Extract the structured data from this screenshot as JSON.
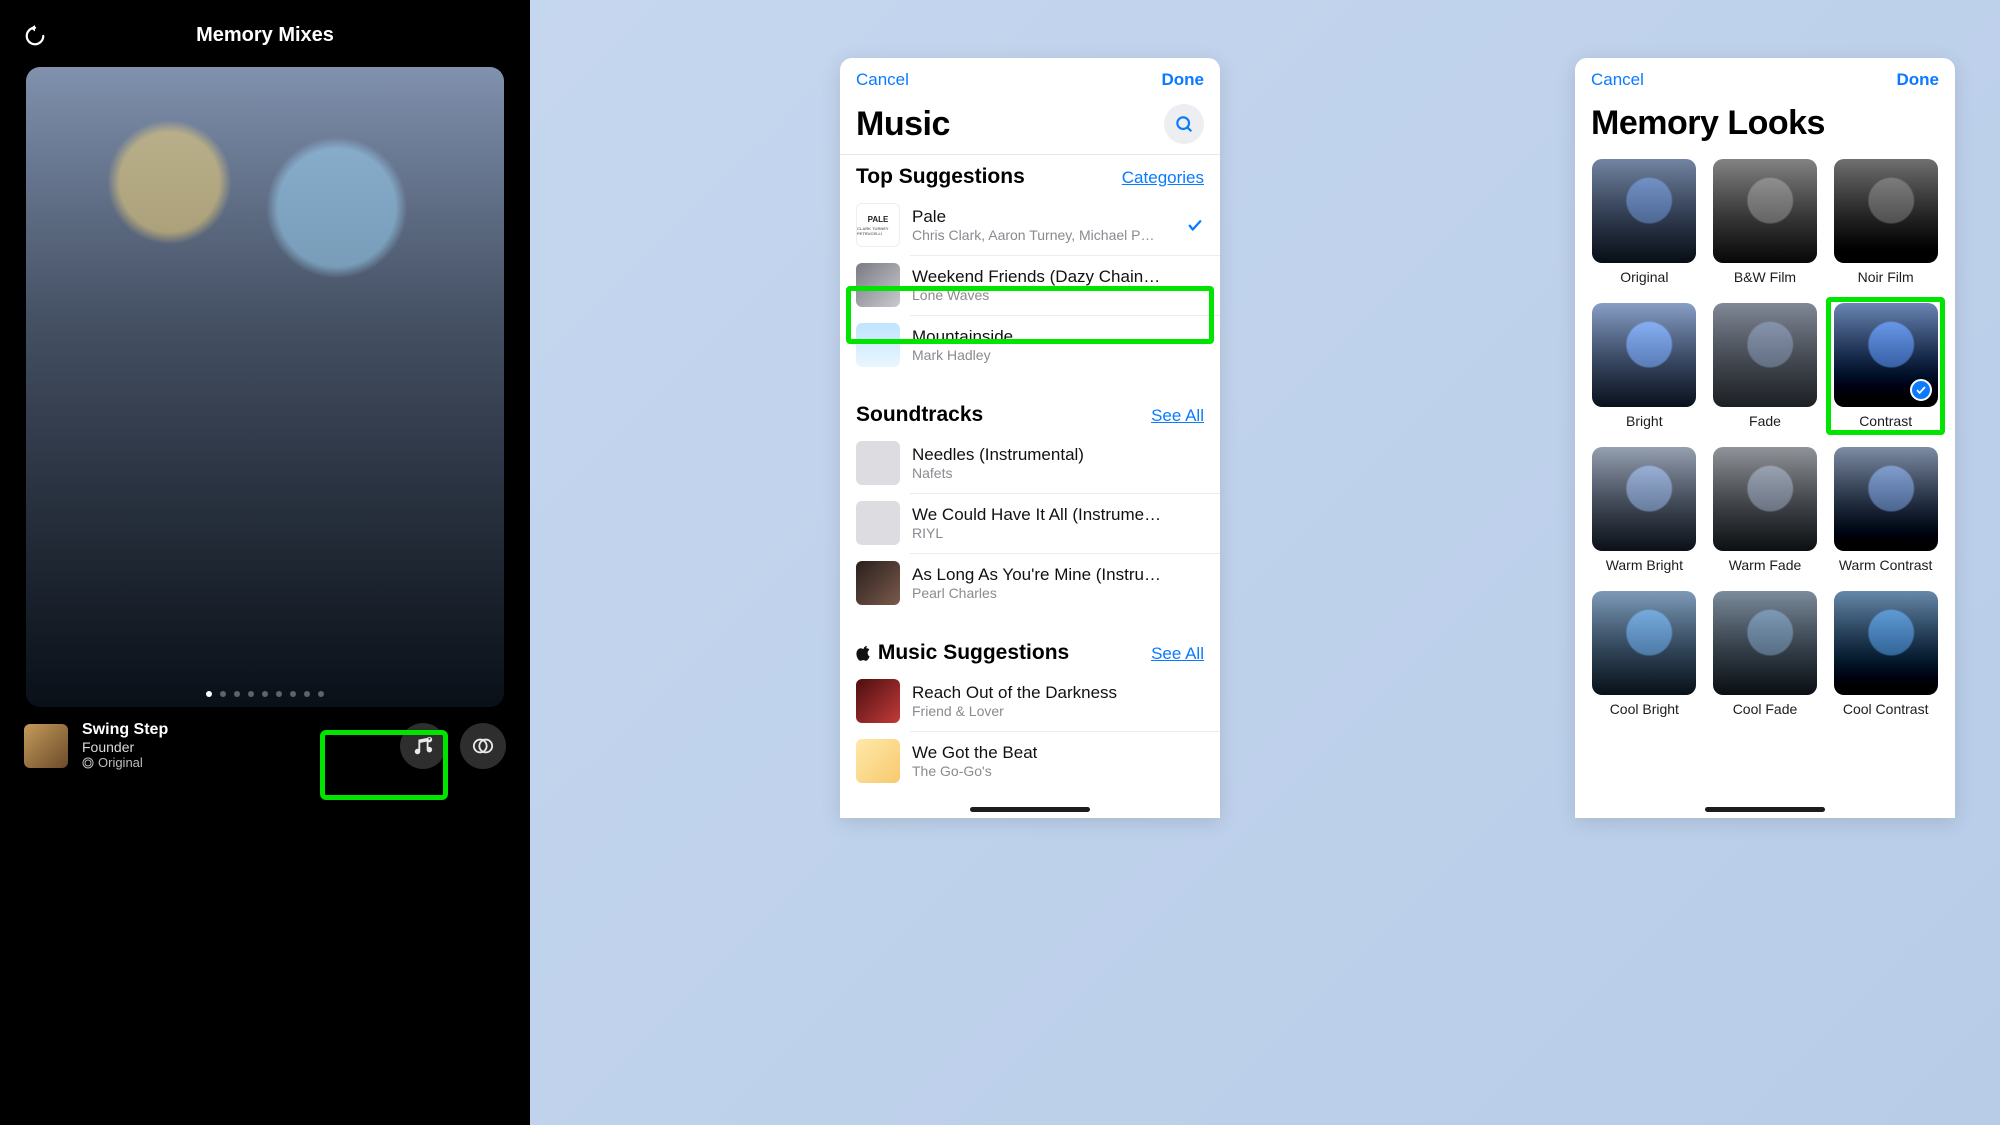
{
  "memory_mixes": {
    "title": "Memory Mixes",
    "dots_total": 9,
    "dots_active_index": 0,
    "track": {
      "title": "Swing Step",
      "artist": "Founder",
      "look_label": "Original"
    }
  },
  "music": {
    "cancel": "Cancel",
    "done": "Done",
    "title": "Music",
    "top_suggestions": {
      "header": "Top Suggestions",
      "link": "Categories",
      "items": [
        {
          "title": "Pale",
          "artist": "Chris Clark, Aaron Turney, Michael Pe…",
          "selected": true,
          "art_text": "PALE"
        },
        {
          "title": "Weekend Friends (Dazy Chain R…",
          "artist": "Lone Waves",
          "selected": false
        },
        {
          "title": "Mountainside",
          "artist": "Mark Hadley",
          "selected": false
        }
      ]
    },
    "soundtracks": {
      "header": "Soundtracks",
      "link": "See All",
      "items": [
        {
          "title": "Needles (Instrumental)",
          "artist": "Nafets"
        },
        {
          "title": "We Could Have It All (Instrumen…",
          "artist": "RIYL"
        },
        {
          "title": "As Long As You're Mine (Instru…",
          "artist": "Pearl Charles"
        }
      ]
    },
    "apple_music": {
      "header": "Music Suggestions",
      "link": "See All",
      "items": [
        {
          "title": "Reach Out of the Darkness",
          "artist": "Friend & Lover"
        },
        {
          "title": "We Got the Beat",
          "artist": "The Go-Go's"
        }
      ]
    }
  },
  "looks": {
    "cancel": "Cancel",
    "done": "Done",
    "title": "Memory Looks",
    "tiles": [
      {
        "label": "Original",
        "cls": "original",
        "selected": false
      },
      {
        "label": "B&W Film",
        "cls": "bw",
        "selected": false
      },
      {
        "label": "Noir Film",
        "cls": "noir",
        "selected": false
      },
      {
        "label": "Bright",
        "cls": "bright",
        "selected": false
      },
      {
        "label": "Fade",
        "cls": "fade",
        "selected": false
      },
      {
        "label": "Contrast",
        "cls": "contrast",
        "selected": true
      },
      {
        "label": "Warm Bright",
        "cls": "warmb",
        "selected": false
      },
      {
        "label": "Warm Fade",
        "cls": "warmf",
        "selected": false
      },
      {
        "label": "Warm Contrast",
        "cls": "warmc",
        "selected": false
      },
      {
        "label": "Cool Bright",
        "cls": "coolb",
        "selected": false
      },
      {
        "label": "Cool Fade",
        "cls": "coolf",
        "selected": false
      },
      {
        "label": "Cool Contrast",
        "cls": "coolc",
        "selected": false
      }
    ]
  }
}
